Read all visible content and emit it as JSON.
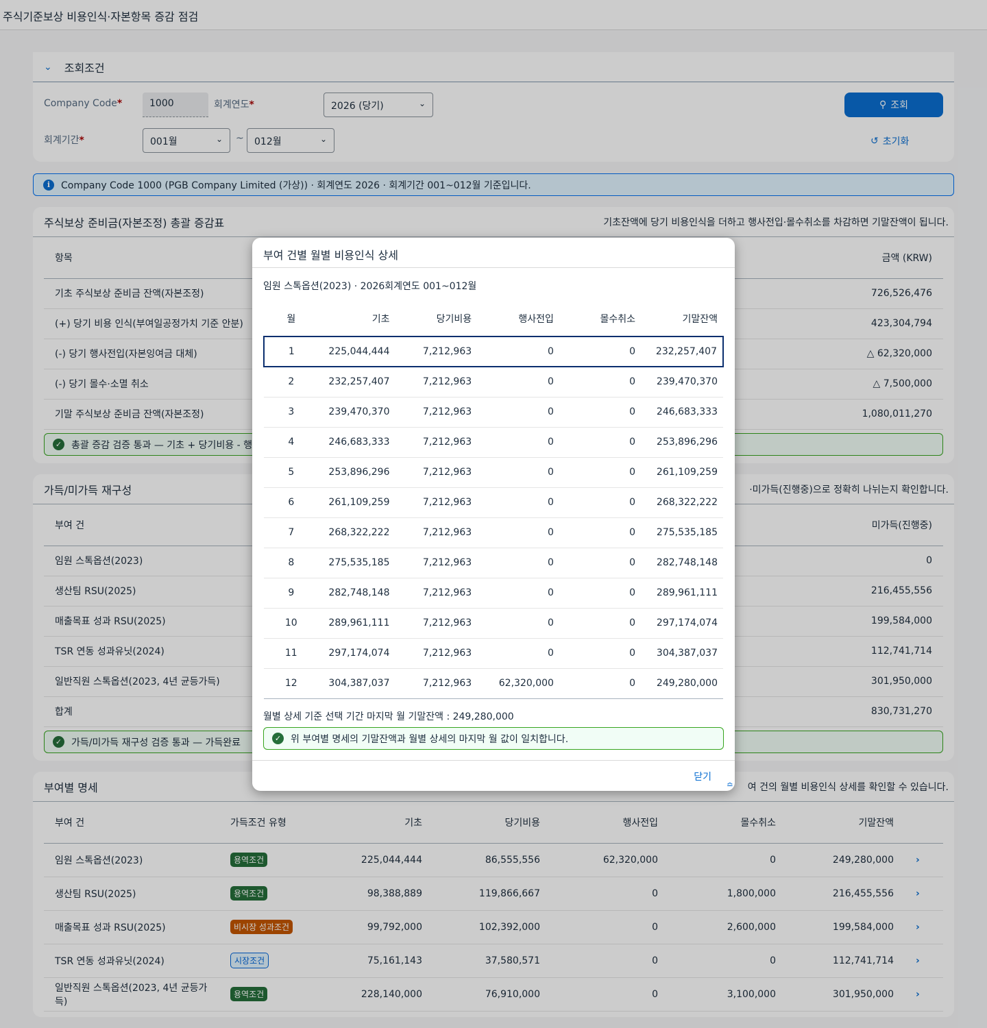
{
  "app": {
    "title": "주식기준보상 비용인식·자본항목 증감 점검"
  },
  "filter": {
    "title": "조회조건",
    "company_code_label": "Company Code",
    "company_code_value": "1000",
    "fiscal_year_label": "회계연도",
    "fiscal_year_value": "2026 (당기)",
    "period_label": "회계기간",
    "period_from": "001월",
    "period_tilde": "~",
    "period_to": "012월",
    "search_label": "조회",
    "reset_label": "초기화",
    "required_mark": "*"
  },
  "info": {
    "text": "Company Code 1000 (PGB Company Limited (가상)) · 회계연도 2026 · 회계기간 001~012월 기준입니다."
  },
  "summary": {
    "title": "주식보상 준비금(자본조정) 총괄 증감표",
    "desc": "기초잔액에 당기 비용인식을 더하고 행사전입·몰수취소를 차감하면 기말잔액이 됩니다.",
    "col_item": "항목",
    "col_amount": "금액 (KRW)",
    "rows": [
      {
        "label": "기초 주식보상 준비금 잔액(자본조정)",
        "amount": "726,526,476"
      },
      {
        "label": "(+) 당기 비용 인식(부여일공정가치 기준 안분)",
        "amount": "423,304,794"
      },
      {
        "label": "(-) 당기 행사전입(자본잉여금 대체)",
        "amount": "△ 62,320,000"
      },
      {
        "label": "(-) 당기 몰수·소멸 취소",
        "amount": "△ 7,500,000"
      },
      {
        "label": "기말 주식보상 준비금 잔액(자본조정)",
        "amount": "1,080,011,270"
      }
    ],
    "ok_text": "총괄 증감 검증 통과 — 기초 + 당기비용 - 행"
  },
  "vesting": {
    "title": "가득/미가득 재구성",
    "desc": "·미가득(진행중)으로 정확히 나뉘는지 확인합니다.",
    "col_grant": "부여 건",
    "col_unvested": "미가득(진행중)",
    "rows": [
      {
        "label": "임원 스톡옵션(2023)",
        "amount": "0"
      },
      {
        "label": "생산팀 RSU(2025)",
        "amount": "216,455,556"
      },
      {
        "label": "매출목표 성과 RSU(2025)",
        "amount": "199,584,000"
      },
      {
        "label": "TSR 연동 성과유닛(2024)",
        "amount": "112,741,714"
      },
      {
        "label": "일반직원 스톡옵션(2023, 4년 균등가득)",
        "amount": "301,950,000"
      },
      {
        "label": "합계",
        "amount": "830,731,270"
      }
    ],
    "ok_text": "가득/미가득 재구성 검증 통과 — 가득완료"
  },
  "grants": {
    "title": "부여별 명세",
    "desc": "여 건의 월별 비용인식 상세를 확인할 수 있습니다.",
    "headers": [
      "부여 건",
      "가득조건 유형",
      "기초",
      "당기비용",
      "행사전입",
      "몰수취소",
      "기말잔액"
    ],
    "rows": [
      {
        "name": "임원 스톡옵션(2023)",
        "type": "용역조건",
        "begin": "225,044,444",
        "expense": "86,555,556",
        "exercise": "62,320,000",
        "forfeit": "0",
        "end": "249,280,000"
      },
      {
        "name": "생산팀 RSU(2025)",
        "type": "용역조건",
        "begin": "98,388,889",
        "expense": "119,866,667",
        "exercise": "0",
        "forfeit": "1,800,000",
        "end": "216,455,556"
      },
      {
        "name": "매출목표 성과 RSU(2025)",
        "type": "비시장 성과조건",
        "begin": "99,792,000",
        "expense": "102,392,000",
        "exercise": "0",
        "forfeit": "2,600,000",
        "end": "199,584,000"
      },
      {
        "name": "TSR 연동 성과유닛(2024)",
        "type": "시장조건",
        "begin": "75,161,143",
        "expense": "37,580,571",
        "exercise": "0",
        "forfeit": "0",
        "end": "112,741,714"
      },
      {
        "name": "일반직원 스톡옵션(2023, 4년 균등가득)",
        "type": "용역조건",
        "begin": "228,140,000",
        "expense": "76,910,000",
        "exercise": "0",
        "forfeit": "3,100,000",
        "end": "301,950,000"
      }
    ]
  },
  "dialog": {
    "title": "부여 건별 월별 비용인식 상세",
    "subtitle": "임원 스톡옵션(2023) · 2026회계연도 001~012월",
    "headers": [
      "월",
      "기초",
      "당기비용",
      "행사전입",
      "몰수취소",
      "기말잔액"
    ],
    "rows": [
      [
        "1",
        "225,044,444",
        "7,212,963",
        "0",
        "0",
        "232,257,407"
      ],
      [
        "2",
        "232,257,407",
        "7,212,963",
        "0",
        "0",
        "239,470,370"
      ],
      [
        "3",
        "239,470,370",
        "7,212,963",
        "0",
        "0",
        "246,683,333"
      ],
      [
        "4",
        "246,683,333",
        "7,212,963",
        "0",
        "0",
        "253,896,296"
      ],
      [
        "5",
        "253,896,296",
        "7,212,963",
        "0",
        "0",
        "261,109,259"
      ],
      [
        "6",
        "261,109,259",
        "7,212,963",
        "0",
        "0",
        "268,322,222"
      ],
      [
        "7",
        "268,322,222",
        "7,212,963",
        "0",
        "0",
        "275,535,185"
      ],
      [
        "8",
        "275,535,185",
        "7,212,963",
        "0",
        "0",
        "282,748,148"
      ],
      [
        "9",
        "282,748,148",
        "7,212,963",
        "0",
        "0",
        "289,961,111"
      ],
      [
        "10",
        "289,961,111",
        "7,212,963",
        "0",
        "0",
        "297,174,074"
      ],
      [
        "11",
        "297,174,074",
        "7,212,963",
        "0",
        "0",
        "304,387,037"
      ],
      [
        "12",
        "304,387,037",
        "7,212,963",
        "62,320,000",
        "0",
        "249,280,000"
      ]
    ],
    "summary_text": "월별 상세 기준 선택 기간 마지막 월 기말잔액 : 249,280,000",
    "ok_text": "위 부여별 명세의 기말잔액과 월별 상세의 마지막 월 값이 일치합니다.",
    "close_label": "닫기"
  }
}
